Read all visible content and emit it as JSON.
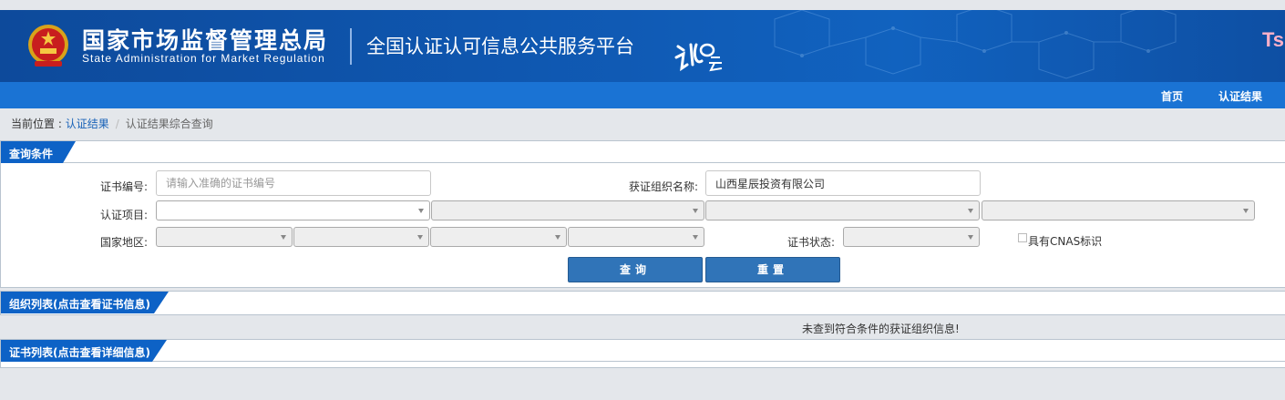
{
  "header": {
    "title_cn": "国家市场监督管理总局",
    "title_en": "State Administration  for  Market Regulation",
    "platform_title": "全国认证认可信息公共服务平台",
    "corner_text": "Tsi"
  },
  "nav": {
    "items": [
      {
        "label": "首页"
      },
      {
        "label": "认证结果"
      }
    ]
  },
  "breadcrumb": {
    "prefix": "当前位置 : ",
    "link": "认证结果",
    "current": "认证结果综合查询"
  },
  "query_panel": {
    "title": "查询条件",
    "cert_no_label": "证书编号:",
    "cert_no_placeholder": "请输入准确的证书编号",
    "org_name_label": "获证组织名称:",
    "org_name_value": "山西星辰投资有限公司",
    "cert_project_label": "认证项目:",
    "region_label": "国家地区:",
    "cert_status_label": "证书状态:",
    "cnas_label": "具有CNAS标识",
    "search_button": "查询",
    "reset_button": "重置"
  },
  "org_list": {
    "title": "组织列表(点击查看证书信息)",
    "empty_message": "未查到符合条件的获证组织信息!"
  },
  "cert_list": {
    "title": "证书列表(点击查看详细信息)"
  },
  "colors": {
    "header_blue": "#0f57b0",
    "nav_blue": "#1a73d4",
    "button_blue": "#3074b8",
    "tab_blue": "#0d62c6"
  }
}
